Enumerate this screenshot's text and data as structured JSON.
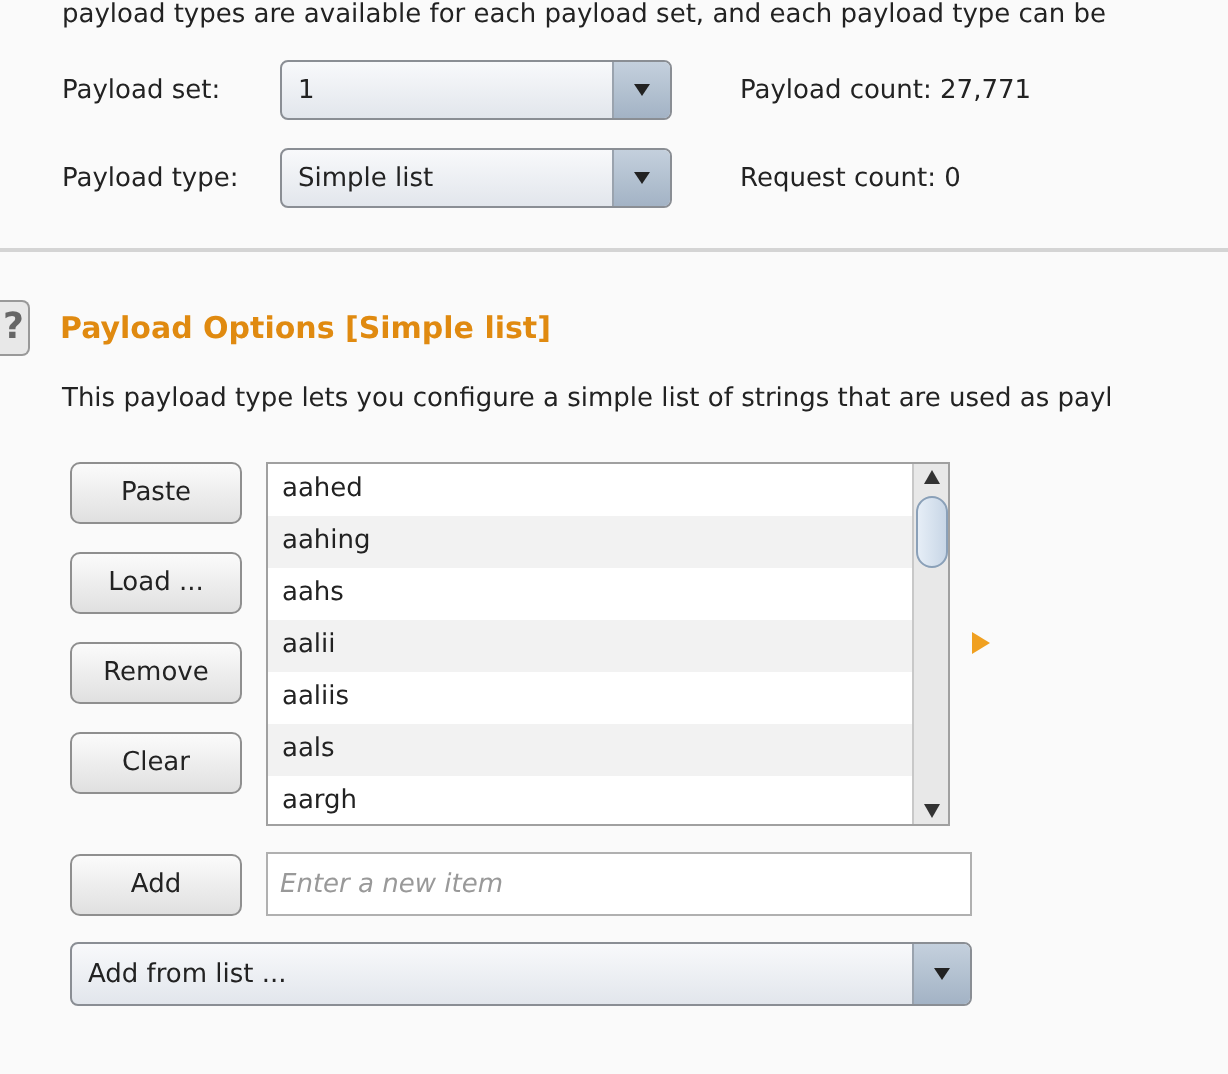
{
  "intro_text": "payload types are available for each payload set, and each payload type can be",
  "settings": [
    {
      "label": "Payload set:",
      "value": "1",
      "info_label": "Payload count:",
      "info_value": "27,771"
    },
    {
      "label": "Payload type:",
      "value": "Simple list",
      "info_label": "Request count:",
      "info_value": "0"
    }
  ],
  "section": {
    "help": "?",
    "title": "Payload Options [Simple list]",
    "description": "This payload type lets you configure a simple list of strings that are used as payl"
  },
  "list_buttons": [
    "Paste",
    "Load ...",
    "Remove",
    "Clear"
  ],
  "items": [
    "aahed",
    "aahing",
    "aahs",
    "aalii",
    "aaliis",
    "aals",
    "aargh"
  ],
  "add_button": "Add",
  "new_item": {
    "placeholder": "Enter a new item"
  },
  "add_from_list": {
    "value": "Add from list ..."
  }
}
